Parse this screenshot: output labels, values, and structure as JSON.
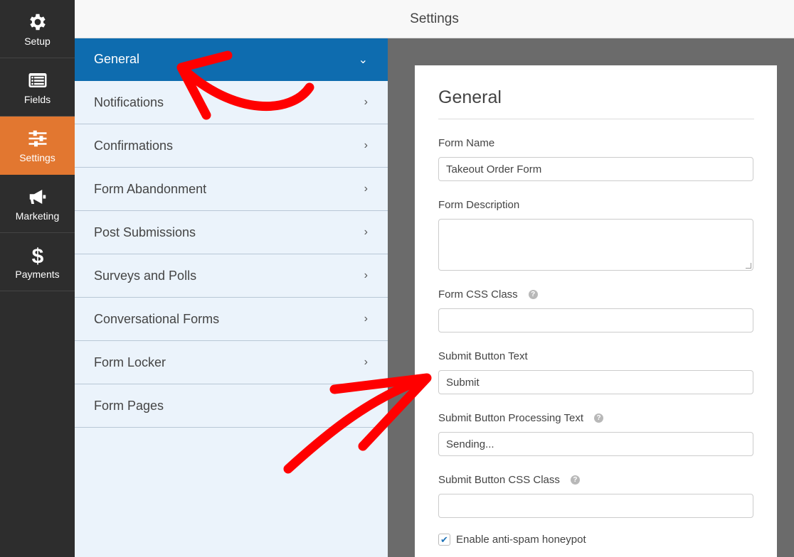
{
  "header": {
    "title": "Settings"
  },
  "icon_sidebar": {
    "items": [
      {
        "label": "Setup",
        "icon": "gear-icon",
        "active": false
      },
      {
        "label": "Fields",
        "icon": "list-icon",
        "active": false
      },
      {
        "label": "Settings",
        "icon": "sliders-icon",
        "active": true
      },
      {
        "label": "Marketing",
        "icon": "megaphone-icon",
        "active": false
      },
      {
        "label": "Payments",
        "icon": "dollar-icon",
        "active": false
      }
    ],
    "active_color": "#e27730"
  },
  "settings_menu": {
    "items": [
      {
        "label": "General",
        "active": true
      },
      {
        "label": "Notifications"
      },
      {
        "label": "Confirmations"
      },
      {
        "label": "Form Abandonment"
      },
      {
        "label": "Post Submissions"
      },
      {
        "label": "Surveys and Polls"
      },
      {
        "label": "Conversational Forms"
      },
      {
        "label": "Form Locker"
      },
      {
        "label": "Form Pages"
      }
    ],
    "active_color": "#0e6caf",
    "chevron_right": "›",
    "chevron_down": "⌄"
  },
  "panel": {
    "title": "General",
    "fields": {
      "form_name": {
        "label": "Form Name",
        "value": "Takeout Order Form"
      },
      "form_description": {
        "label": "Form Description",
        "value": ""
      },
      "form_css_class": {
        "label": "Form CSS Class",
        "value": ""
      },
      "submit_text": {
        "label": "Submit Button Text",
        "value": "Submit"
      },
      "submit_processing": {
        "label": "Submit Button Processing Text",
        "value": "Sending..."
      },
      "submit_css_class": {
        "label": "Submit Button CSS Class",
        "value": ""
      }
    },
    "honeypot": {
      "label": "Enable anti-spam honeypot",
      "checked": true
    },
    "help_glyph": "?"
  },
  "annotation_color": "#ff0000"
}
